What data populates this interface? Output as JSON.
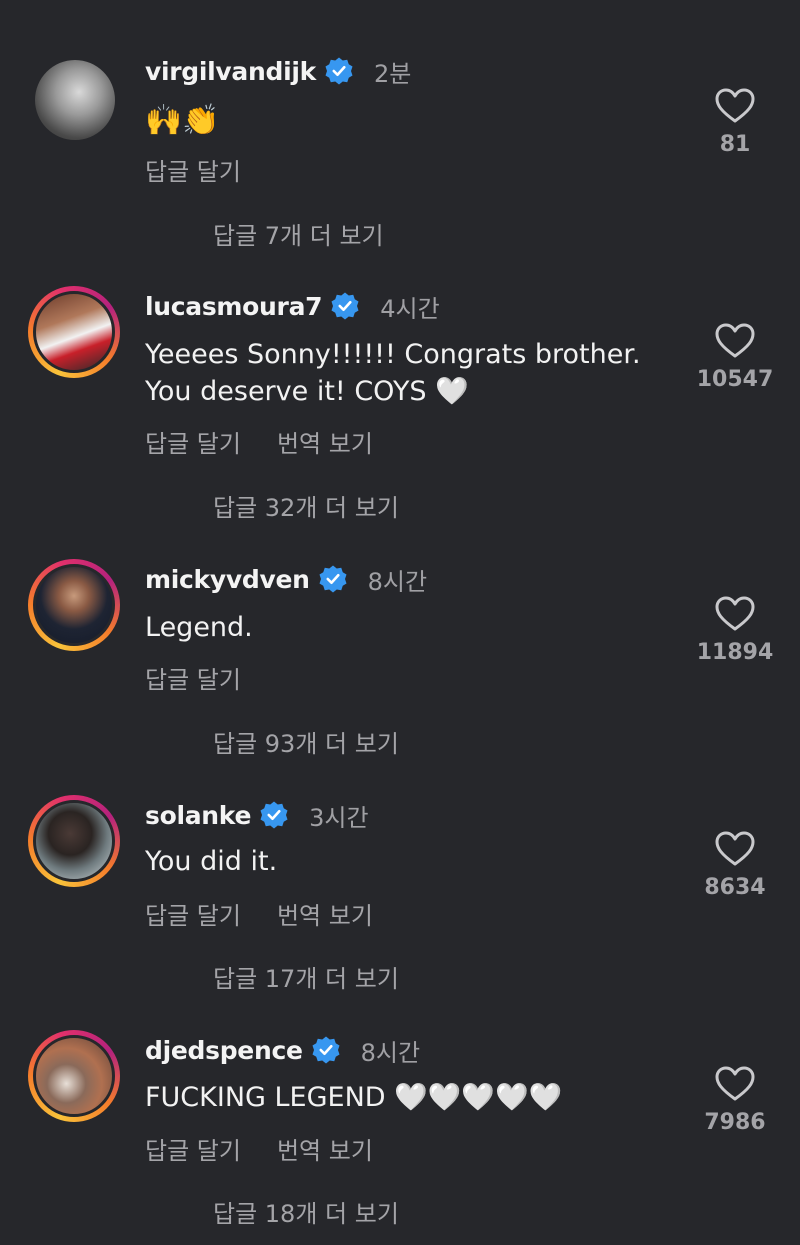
{
  "comments": [
    {
      "username": "virgilvandijk",
      "time": "2분",
      "text": "🙌👏",
      "actions": [
        "답글 달기"
      ],
      "more_replies": "답글 7개 더 보기",
      "likes": "81",
      "avatar_ring": false
    },
    {
      "username": "lucasmoura7",
      "time": "4시간",
      "text": "Yeeees Sonny!!!!!! Congrats brother.\nYou deserve it! COYS 🤍",
      "actions": [
        "답글 달기",
        "번역 보기"
      ],
      "more_replies": "답글 32개 더 보기",
      "likes": "10547",
      "avatar_ring": true
    },
    {
      "username": "mickyvdven",
      "time": "8시간",
      "text": "Legend.",
      "actions": [
        "답글 달기"
      ],
      "more_replies": "답글 93개 더 보기",
      "likes": "11894",
      "avatar_ring": true
    },
    {
      "username": "solanke",
      "time": "3시간",
      "text": "You did it.",
      "actions": [
        "답글 달기",
        "번역 보기"
      ],
      "more_replies": "답글 17개 더 보기",
      "likes": "8634",
      "avatar_ring": true
    },
    {
      "username": "djedspence",
      "time": "8시간",
      "text": "FUCKING LEGEND 🤍🤍🤍🤍🤍",
      "actions": [
        "답글 달기",
        "번역 보기"
      ],
      "more_replies": "답글 18개 더 보기",
      "likes": "7986",
      "avatar_ring": true
    }
  ],
  "colors": {
    "background": "#26272b",
    "verified_badge": "#3797f0",
    "secondary_text": "#a4a4a8"
  },
  "icons": {
    "verified": "verified-badge-icon",
    "like": "heart-outline-icon"
  }
}
